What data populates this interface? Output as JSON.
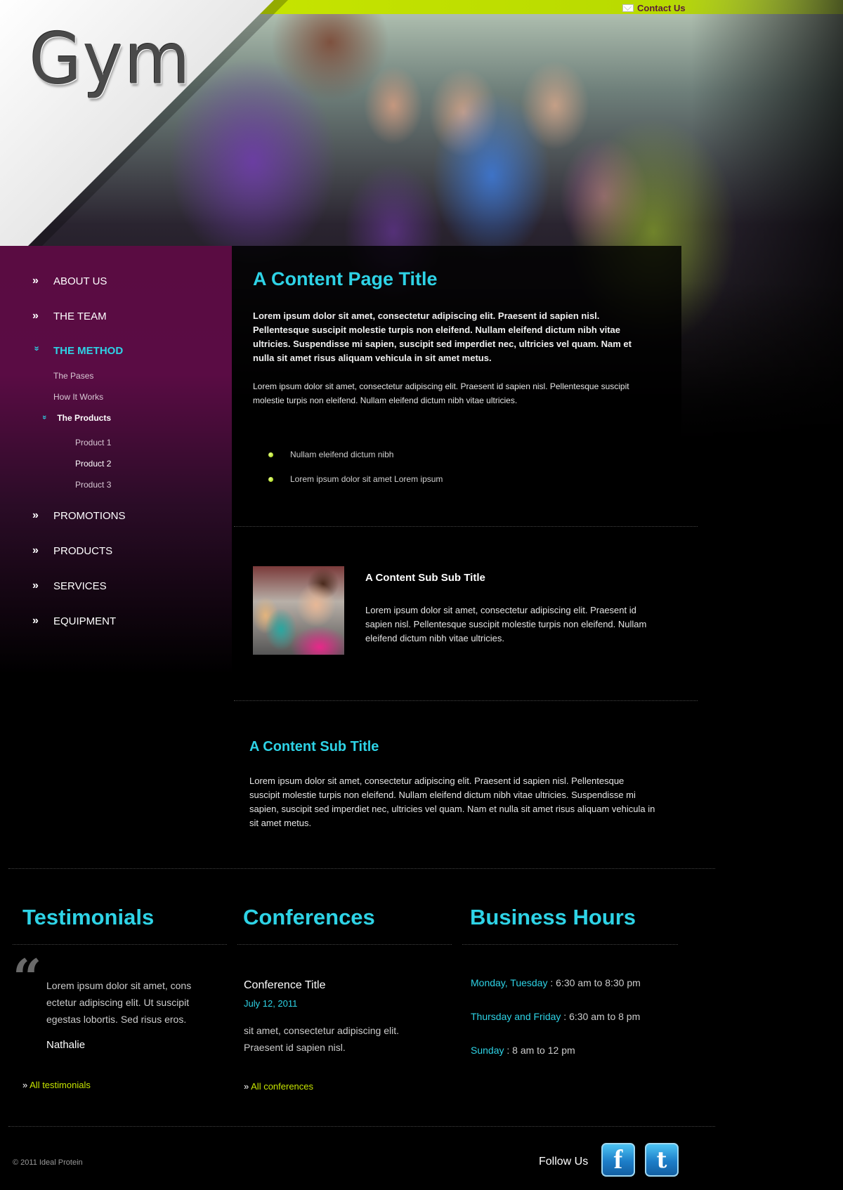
{
  "header": {
    "logo": "Gym",
    "contact_label": "Contact Us"
  },
  "sidebar": {
    "items": [
      {
        "label": "ABOUT US"
      },
      {
        "label": "THE TEAM"
      },
      {
        "label": "THE METHOD"
      },
      {
        "label": "PROMOTIONS"
      },
      {
        "label": "PRODUCTS"
      },
      {
        "label": "SERVICES"
      },
      {
        "label": "EQUIPMENT"
      }
    ],
    "method_sub": [
      {
        "label": "The Pases"
      },
      {
        "label": "How It Works"
      },
      {
        "label": "The Products"
      }
    ],
    "products_sub": [
      {
        "label": "Product 1"
      },
      {
        "label": "Product 2"
      },
      {
        "label": "Product 3"
      }
    ],
    "arrow": "»",
    "expanded_arrow": "»"
  },
  "main": {
    "title": "A Content Page Title",
    "lead": "Lorem ipsum dolor sit amet, consectetur adipiscing elit. Praesent id sapien nisl. Pellentesque suscipit molestie turpis non eleifend. Nullam eleifend dictum nibh vitae ultricies. Suspendisse mi sapien, suscipit sed imperdiet nec, ultricies vel quam. Nam et nulla sit amet risus aliquam vehicula in sit amet metus.",
    "body": "Lorem ipsum dolor sit amet, consectetur adipiscing elit. Praesent id sapien nisl. Pellentesque suscipit molestie turpis non eleifend. Nullam eleifend dictum nibh vitae ultricies.",
    "bullets": [
      "Nullam eleifend dictum nibh",
      "Lorem ipsum dolor sit amet Lorem ipsum"
    ],
    "sub_sub_title": "A Content Sub Sub Title",
    "sub_sub_text": "Lorem ipsum dolor sit amet, consectetur adipiscing elit. Praesent id sapien nisl. Pellentesque suscipit molestie turpis non eleifend. Nullam eleifend dictum nibh vitae ultricies.",
    "sub_title": "A Content Sub Title",
    "sub_text": "Lorem ipsum dolor sit amet, consectetur adipiscing elit. Praesent id sapien nisl. Pellentesque suscipit molestie turpis non eleifend. Nullam eleifend dictum nibh vitae ultricies. Suspendisse mi sapien, suscipit sed imperdiet nec, ultricies vel quam. Nam et nulla sit amet risus aliquam vehicula in sit amet metus."
  },
  "testimonials": {
    "title": "Testimonials",
    "quote_mark": "“",
    "text": "Lorem ipsum dolor sit amet, cons ectetur adipiscing elit. Ut suscipit egestas lobortis. Sed risus eros.",
    "author": "Nathalie",
    "link_prefix": "»",
    "link": "All testimonials"
  },
  "conferences": {
    "title": "Conferences",
    "item_title": "Conference Title",
    "item_date": "July 12, 2011",
    "item_text": "sit amet, consectetur adipiscing elit. Praesent id sapien nisl.",
    "link_prefix": "»",
    "link": "All conferences"
  },
  "business_hours": {
    "title": "Business Hours",
    "rows": [
      {
        "day": "Monday, Tuesday",
        "hours": " : 6:30 am to 8:30 pm"
      },
      {
        "day": "Thursday and Friday",
        "hours": " : 6:30 am to 8 pm"
      },
      {
        "day": "Sunday",
        "hours": " : 8 am to 12 pm"
      }
    ]
  },
  "footer": {
    "copyright": "© 2011 Ideal Protein",
    "follow_us": "Follow Us",
    "facebook_glyph": "f",
    "twitter_glyph": "t"
  },
  "colors": {
    "accent": "#2ed3e6",
    "lime": "#c6e400",
    "sidebar_purple": "#5a0c42"
  }
}
